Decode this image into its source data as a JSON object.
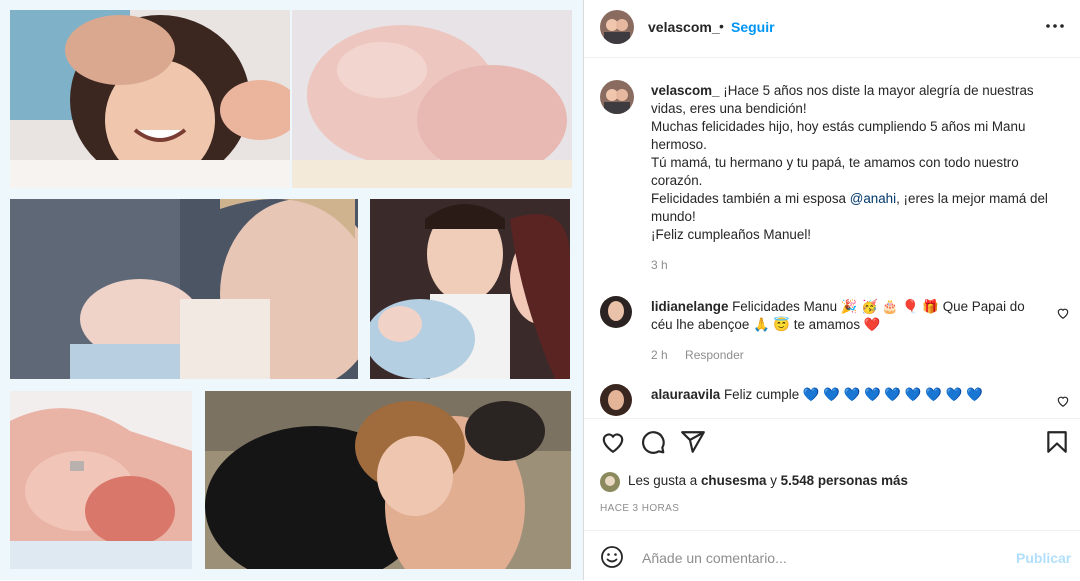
{
  "post": {
    "username": "velascom_",
    "separator": "•",
    "follow_label": "Seguir",
    "more_icon": "more-options-icon"
  },
  "caption": {
    "username": "velascom_",
    "line1": "¡Hace 5 años nos diste la mayor alegría de nuestras vidas, eres una bendición!",
    "line2": "Muchas felicidades hijo, hoy estás cumpliendo 5 años mi Manu hermoso.",
    "line3": "Tú mamá, tu hermano y tu papá, te amamos con todo nuestro corazón.",
    "line4_prefix": "Felicidades también a mi esposa ",
    "line4_mention": "@anahi",
    "line4_suffix": ", ¡eres la mejor mamá del mundo!",
    "line5": "¡Feliz cumpleaños Manuel!",
    "time": "3 h"
  },
  "comments": [
    {
      "username": "lidianelange",
      "text": "Felicidades Manu 🎉 🥳 🎂 🎈 🎁 Que Papai do céu lhe abençoe 🙏 😇 te amamos ❤️",
      "time": "2 h",
      "reply_label": "Responder"
    },
    {
      "username": "alauraavila",
      "text": "Feliz cumple 💙 💙 💙 💙 💙 💙 💙 💙 💙"
    }
  ],
  "likes": {
    "prefix": "Les gusta a ",
    "user": "chusesma",
    "middle": " y ",
    "count": "5.548 personas más"
  },
  "posted_ago": "HACE 3 HORAS",
  "add_comment": {
    "placeholder": "Añade un comentario...",
    "publish_label": "Publicar"
  },
  "colors": {
    "accent": "#0095f6",
    "publish_disabled": "#b2dffc",
    "heart_red": "#ed4956"
  }
}
